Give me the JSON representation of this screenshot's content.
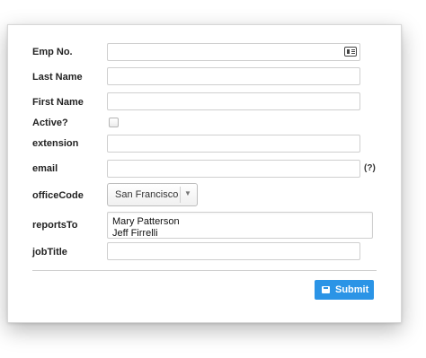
{
  "form": {
    "emp_no": {
      "label": "Emp No.",
      "value": ""
    },
    "last_name": {
      "label": "Last Name",
      "value": ""
    },
    "first_name": {
      "label": "First Name",
      "value": ""
    },
    "active": {
      "label": "Active?",
      "checked": false
    },
    "extension": {
      "label": "extension",
      "value": ""
    },
    "email": {
      "label": "email",
      "value": "",
      "help": "(?)"
    },
    "office_code": {
      "label": "officeCode",
      "selected": "San Francisco"
    },
    "reports_to": {
      "label": "reportsTo",
      "options": [
        "Mary Patterson",
        "Jeff Firrelli"
      ]
    },
    "job_title": {
      "label": "jobTitle",
      "value": ""
    }
  },
  "actions": {
    "submit_label": "Submit"
  },
  "icons": {
    "emp_no_field": "id-card-icon",
    "office_dropdown": "chevron-down-icon",
    "submit": "save-icon"
  },
  "colors": {
    "submit_button": "#2b94e6"
  }
}
